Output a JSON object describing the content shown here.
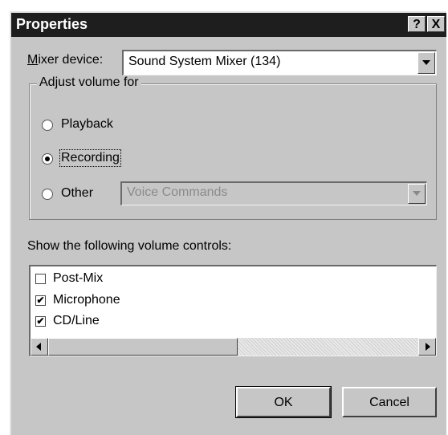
{
  "window": {
    "title": "Properties",
    "help_button": "?",
    "close_button": "X"
  },
  "mixer": {
    "label_accel": "M",
    "label_rest": "ixer device:",
    "selected": "Sound System Mixer (134)"
  },
  "adjust_volume": {
    "legend": "Adjust volume for",
    "options": [
      {
        "label": "Playback",
        "checked": false
      },
      {
        "label": "Recording",
        "checked": true
      },
      {
        "label": "Other",
        "checked": false
      }
    ],
    "other_select": {
      "value": "Voice Commands",
      "disabled": true
    }
  },
  "controls": {
    "label": "Show the following volume controls:",
    "items": [
      {
        "label": "Post-Mix",
        "checked": false
      },
      {
        "label": "Microphone",
        "checked": true
      },
      {
        "label": "CD/Line",
        "checked": true
      }
    ]
  },
  "buttons": {
    "ok": "OK",
    "cancel": "Cancel"
  },
  "icons": {
    "check": "✔"
  }
}
